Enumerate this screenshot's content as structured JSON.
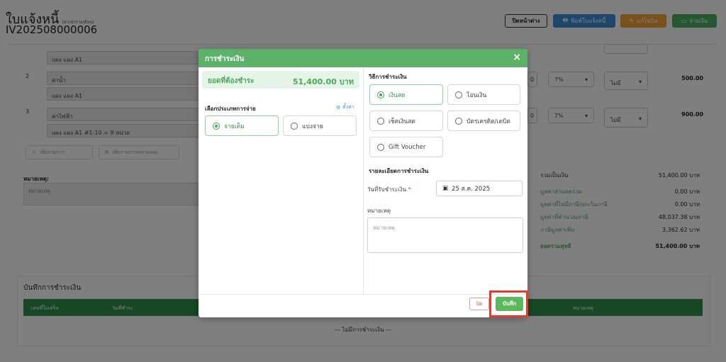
{
  "header": {
    "title": "ใบแจ้งหนี้",
    "subtitle": "(ค่าเช่ารายเดือน)",
    "doc_number": "IV202508000006",
    "buttons": {
      "close_label": "ปิดหน้าต่าง",
      "print_label": "พิมพ์ใบแจ้งหนี้",
      "edit_label": "แก้ไขบิล",
      "pay_label": "จ่ายเงิน"
    }
  },
  "items": [
    {
      "no": "",
      "name": "",
      "desc": "แผง แผง A1",
      "vat": "",
      "tax": "",
      "amount": ""
    },
    {
      "no": "2",
      "name": "ค่าน้ำ",
      "desc": "แผง แผง A1",
      "qty": "0",
      "vat": "7%",
      "tax": "ไม่มี",
      "amount": "500.00"
    },
    {
      "no": "3",
      "name": "ค่าไฟฟ้า",
      "desc": "แผง แผง A1 #1-10 = 9 หน่วย",
      "qty": "0",
      "vat": "7%",
      "tax": "ไม่มี",
      "amount": "900.00"
    }
  ],
  "add_buttons": {
    "add_item": "เพิ่มรายการ",
    "add_multi": "เพิ่มรายการหลายแผง"
  },
  "remark": {
    "label": "หมายเหตุ:",
    "placeholder": "หมายเหตุ"
  },
  "summary": [
    {
      "label": "รวมเป็นเงิน",
      "value": "51,400.00 บาท"
    },
    {
      "label": "มูลค่าส่วนลดรวม",
      "value": "0.00 บาท"
    },
    {
      "label": "มูลค่าที่ไม่มีภาษี/ยกเว้นภาษี",
      "value": "0.00 บาท"
    },
    {
      "label": "มูลค่าที่คำนวณภาษี",
      "value": "48,037.38 บาท"
    },
    {
      "label": "ภาษีมูลค่าเพิ่ม",
      "value": "3,362.62 บาท"
    },
    {
      "label": "ยอดรวมสุทธิ",
      "value": "51,400.00 บาท"
    }
  ],
  "payment_history": {
    "title": "บันทึกการชำระเงิน",
    "columns": [
      "เลขที่ใบเสร็จ",
      "วันที่ชำระ",
      "หมายเหตุ"
    ],
    "empty": "--- ไม่มีการชำระเงิน ---"
  },
  "modal": {
    "title": "การชำระเงิน",
    "close_glyph": "×",
    "amount_label": "ยอดที่ต้องชำระ",
    "amount_value": "51,400.00 บาท",
    "pay_type_title": "เลือกประเภทการจ่าย",
    "settings_label": "ตั้งค่า",
    "pay_types": [
      {
        "label": "จ่ายเต็ม",
        "selected": true
      },
      {
        "label": "แบ่งจ่าย",
        "selected": false
      }
    ],
    "method_title": "วิธีการชำระเงิน",
    "methods": [
      {
        "label": "เงินสด",
        "selected": true
      },
      {
        "label": "โอนเงิน",
        "selected": false
      },
      {
        "label": "เช็คเงินสด",
        "selected": false
      },
      {
        "label": "บัตรเครดิต/เดบิต",
        "selected": false
      },
      {
        "label": "Gift Voucher",
        "selected": false
      }
    ],
    "details_title": "รายละเอียดการชำระเงิน",
    "date_label": "วันที่รับชำระเงิน",
    "required_mark": "*",
    "date_value": "25 ส.ค. 2025",
    "remark_label": "หมายเหตุ",
    "remark_placeholder": "หมายเหตุ",
    "cancel_label": "ปิด",
    "save_label": "บันทึก"
  },
  "colors": {
    "modal_header": "#5cb269",
    "save_button": "#5cb85c",
    "highlight": "#e43d2b",
    "print_button": "#3f8fd6",
    "edit_button": "#f0a23a",
    "pay_button": "#4caf63"
  }
}
